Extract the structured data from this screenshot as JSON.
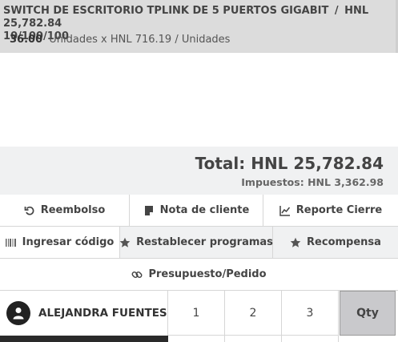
{
  "order_line": {
    "product_name": "SWITCH DE ESCRITORIO TPLINK DE 5 PUERTOS GIGABIT",
    "separator": "/",
    "price": "HNL 25,782.84",
    "product_spec": "10/100/100",
    "quantity": "36.00",
    "unit_price_text": "Unidades x HNL 716.19 / Unidades"
  },
  "totals": {
    "total_label": "Total:",
    "total_value": "HNL 25,782.84",
    "tax_label": "Impuestos:",
    "tax_value": "HNL 3,362.98"
  },
  "actions": {
    "refund": "Reembolso",
    "customer_note": "Nota de cliente",
    "close_report": "Reporte Cierre",
    "enter_code": "Ingresar código",
    "reset_programs": "Restablecer programas",
    "reward": "Recompensa",
    "quotation": "Presupuesto/Pedido"
  },
  "numpad": {
    "customer_name": "ALEJANDRA FUENTES",
    "keys": [
      "1",
      "2",
      "3"
    ],
    "mode": "Qty"
  },
  "icons": [
    "undo-icon",
    "note-icon",
    "chart-icon",
    "barcode-icon",
    "star-icon",
    "star-icon",
    "link-icon",
    "user-icon"
  ]
}
